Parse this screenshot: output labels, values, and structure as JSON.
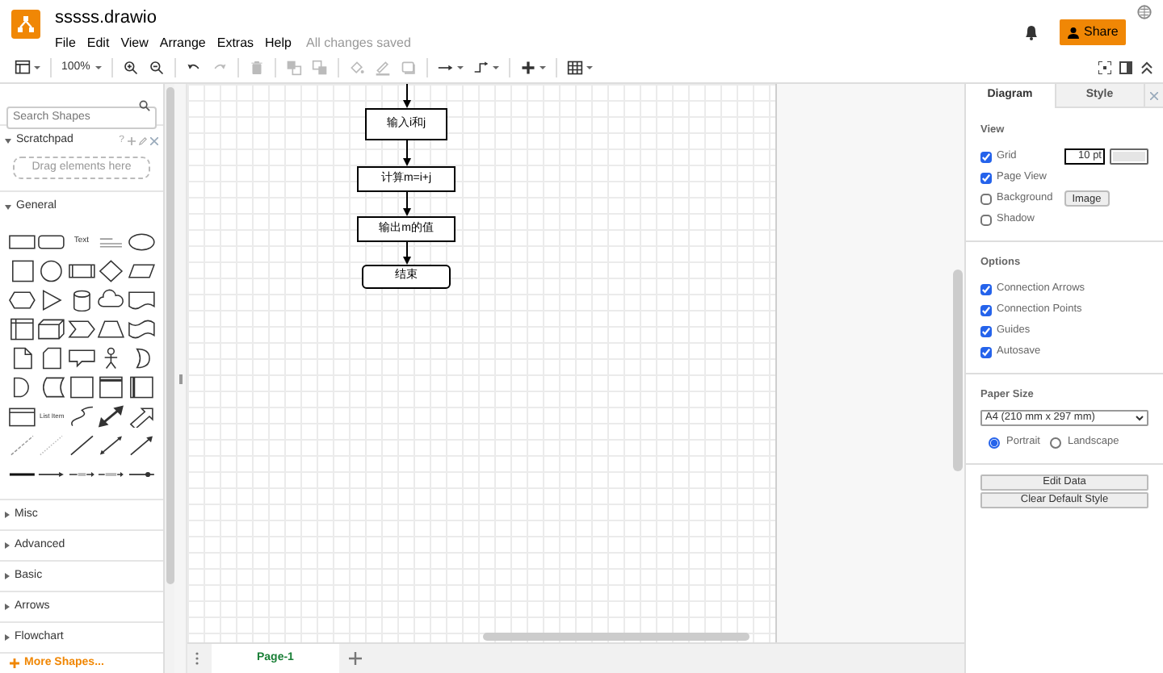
{
  "app": {
    "title": "sssss.drawio",
    "menu": [
      "File",
      "Edit",
      "View",
      "Arrange",
      "Extras",
      "Help"
    ],
    "save_status": "All changes saved",
    "share_label": "Share"
  },
  "toolbar": {
    "zoom": "100%",
    "tools": [
      {
        "kind": "panel",
        "disabled": false
      },
      {
        "kind": "zoom",
        "disabled": false
      },
      {
        "kind": "zoom_in",
        "disabled": false
      },
      {
        "kind": "zoom_out",
        "disabled": false
      },
      {
        "kind": "undo",
        "disabled": false
      },
      {
        "kind": "redo",
        "disabled": true
      },
      {
        "kind": "delete",
        "disabled": true
      },
      {
        "kind": "to_front",
        "disabled": true
      },
      {
        "kind": "to_back",
        "disabled": true
      },
      {
        "kind": "fill",
        "disabled": true
      },
      {
        "kind": "line_color",
        "disabled": true
      },
      {
        "kind": "shadow",
        "disabled": true
      },
      {
        "kind": "connection",
        "disabled": false
      },
      {
        "kind": "waypoints",
        "disabled": false
      },
      {
        "kind": "insert",
        "disabled": false
      },
      {
        "kind": "table",
        "disabled": false
      }
    ]
  },
  "sidebar": {
    "search": {
      "placeholder": "Search Shapes"
    },
    "scratchpad": {
      "title": "Scratchpad",
      "expanded": true,
      "help": "?",
      "drop_hint": "Drag elements here"
    },
    "general": {
      "title": "General",
      "expanded": true,
      "text_label": "Text",
      "list_item_label": "List Item"
    },
    "sections": [
      {
        "title": "Misc",
        "expanded": false
      },
      {
        "title": "Advanced",
        "expanded": false
      },
      {
        "title": "Basic",
        "expanded": false
      },
      {
        "title": "Arrows",
        "expanded": false
      },
      {
        "title": "Flowchart",
        "expanded": false
      }
    ],
    "more_shapes": "More Shapes..."
  },
  "canvas": {
    "nodes": [
      {
        "label": "输入i和j",
        "kind": "process"
      },
      {
        "label": "计算m=i+j",
        "kind": "process"
      },
      {
        "label": "输出m的值",
        "kind": "process"
      },
      {
        "label": "结束",
        "kind": "terminator"
      }
    ]
  },
  "page_tabs": [
    {
      "label": "Page-1",
      "selected": true
    }
  ],
  "format_panel": {
    "tabs": [
      {
        "label": "Diagram",
        "selected": true
      },
      {
        "label": "Style",
        "selected": false
      }
    ],
    "view": {
      "title": "View",
      "items": [
        {
          "label": "Grid",
          "checked": true,
          "kind": "grid",
          "value": "10 pt"
        },
        {
          "label": "Page View",
          "checked": true,
          "kind": "plain"
        },
        {
          "label": "Background",
          "checked": false,
          "kind": "background",
          "button": "Image"
        },
        {
          "label": "Shadow",
          "checked": false,
          "kind": "plain"
        }
      ]
    },
    "options": {
      "title": "Options",
      "items": [
        {
          "label": "Connection Arrows",
          "checked": true
        },
        {
          "label": "Connection Points",
          "checked": true
        },
        {
          "label": "Guides",
          "checked": true
        },
        {
          "label": "Autosave",
          "checked": true
        }
      ]
    },
    "paper": {
      "title": "Paper Size",
      "size": "A4 (210 mm x 297 mm)",
      "orientations": [
        {
          "label": "Portrait",
          "selected": true
        },
        {
          "label": "Landscape",
          "selected": false
        }
      ]
    },
    "buttons": [
      "Edit Data",
      "Clear Default Style"
    ]
  }
}
